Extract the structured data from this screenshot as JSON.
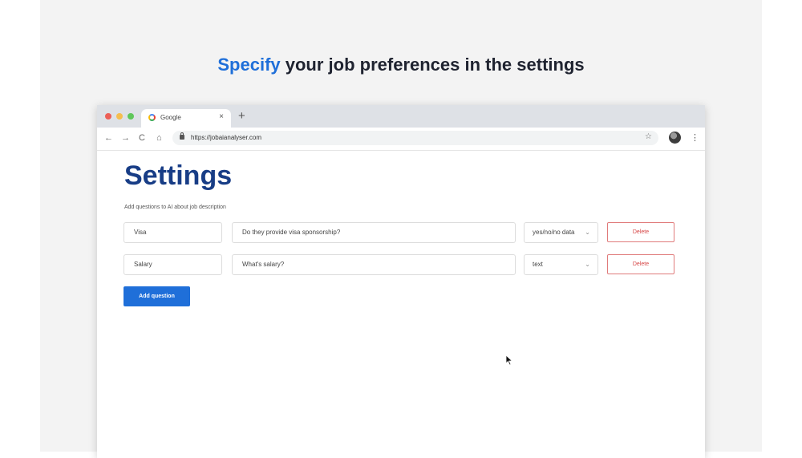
{
  "headline": {
    "accent": "Specify",
    "rest": " your job preferences in the settings"
  },
  "browser": {
    "tab_title": "Google",
    "tab_close": "×",
    "new_tab": "+",
    "url": "https://jobaianalyser.com",
    "nav": {
      "back": "←",
      "forward": "→",
      "reload": "C",
      "home": "⌂"
    },
    "star": "☆",
    "menu": "⋮"
  },
  "page": {
    "title": "Settings",
    "description": "Add questions to AI about job description",
    "questions": [
      {
        "name": "Visa",
        "question": "Do they provide visa sponsorship?",
        "type": "yes/no/no data"
      },
      {
        "name": "Salary",
        "question": "What's salary?",
        "type": "text"
      }
    ],
    "delete_label": "Delete",
    "add_label": "Add question"
  },
  "colors": {
    "accent": "#1f6fd9",
    "title": "#183d86",
    "danger": "#d64545"
  },
  "icons": [
    "google-icon",
    "lock-icon",
    "star-icon",
    "avatar",
    "menu-icon",
    "chevron-down-icon",
    "cursor-icon"
  ]
}
